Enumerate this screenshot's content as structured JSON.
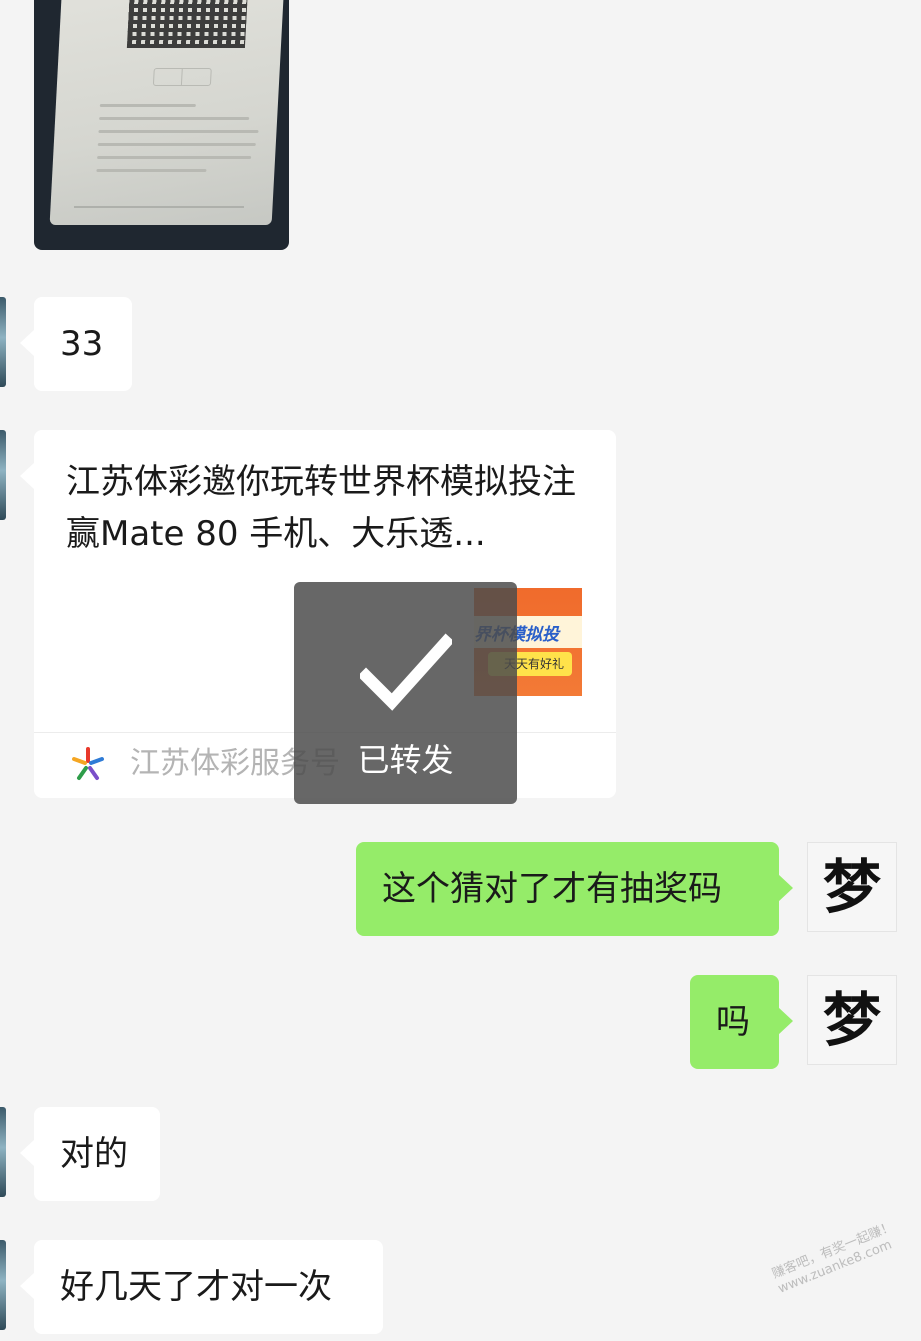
{
  "chat": {
    "messages": [
      {
        "from": "other",
        "type": "text",
        "text": "33"
      },
      {
        "from": "other",
        "type": "share_card",
        "title": "江苏体彩邀你玩转世界杯模拟投注 赢Mate 80 手机、大乐透...",
        "thumbnail_line1": "界杯模拟投",
        "thumbnail_line2": "天天有好礼",
        "source": "江苏体彩服务号"
      },
      {
        "from": "me",
        "type": "text",
        "text": "这个猜对了才有抽奖码"
      },
      {
        "from": "me",
        "type": "text",
        "text": "吗"
      },
      {
        "from": "other",
        "type": "text",
        "text": "对的"
      },
      {
        "from": "other",
        "type": "text",
        "text": "好几天了才对一次"
      }
    ],
    "my_avatar_char": "梦"
  },
  "toast": {
    "label": "已转发",
    "icon": "checkmark-icon"
  },
  "watermark": {
    "line1": "赚客吧，有奖一起赚！",
    "line2": "www.zuanke8.com"
  },
  "colors": {
    "background": "#f4f4f4",
    "my_bubble": "#95ec69",
    "other_bubble": "#ffffff",
    "toast": "#4c4c4c"
  }
}
